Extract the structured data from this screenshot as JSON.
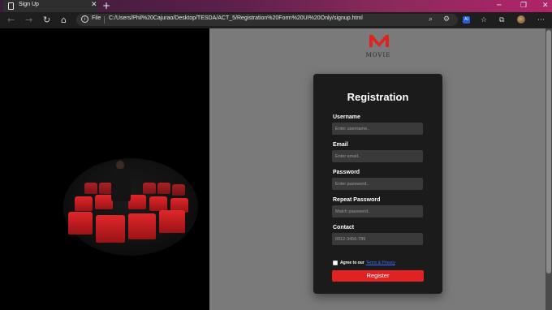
{
  "browser": {
    "tab_title": "Sign Up",
    "new_tab_symbol": "+",
    "address_label": "File",
    "url": "C:/Users/Phil%20Cajurao/Desktop/TESDA/ACT_5/Registration%20Form%20UI%20Only/signup.html",
    "extension_badge": "AI",
    "icons": [
      "page-icon",
      "close-icon",
      "new-tab-icon",
      "minimize-icon",
      "maximize-icon",
      "close-window-icon",
      "back-icon",
      "forward-icon",
      "refresh-icon",
      "home-icon",
      "info-icon",
      "zoom-icon",
      "read-aloud-icon",
      "extension-icon",
      "favorites-icon",
      "collections-icon",
      "profile-avatar",
      "more-icon"
    ]
  },
  "brand": {
    "logo_letter": "M",
    "name": "MOVIE"
  },
  "form": {
    "title": "Registration",
    "fields": [
      {
        "label": "Username",
        "placeholder": "Enter username..",
        "value": ""
      },
      {
        "label": "Email",
        "placeholder": "Enter email..",
        "value": ""
      },
      {
        "label": "Password",
        "placeholder": "Enter password..",
        "value": ""
      },
      {
        "label": "Repeat Password",
        "placeholder": "Match password..",
        "value": ""
      },
      {
        "label": "Contact",
        "placeholder": "0912-3456-789",
        "value": ""
      }
    ],
    "agree_text": "Agree to our",
    "agree_link": "Terms & Privacy",
    "agree_checked": false,
    "submit_label": "Register"
  },
  "colors": {
    "accent": "#e02222",
    "card": "#1b1b1b",
    "page_bg": "#7a7a7a",
    "link": "#3b6cff"
  }
}
